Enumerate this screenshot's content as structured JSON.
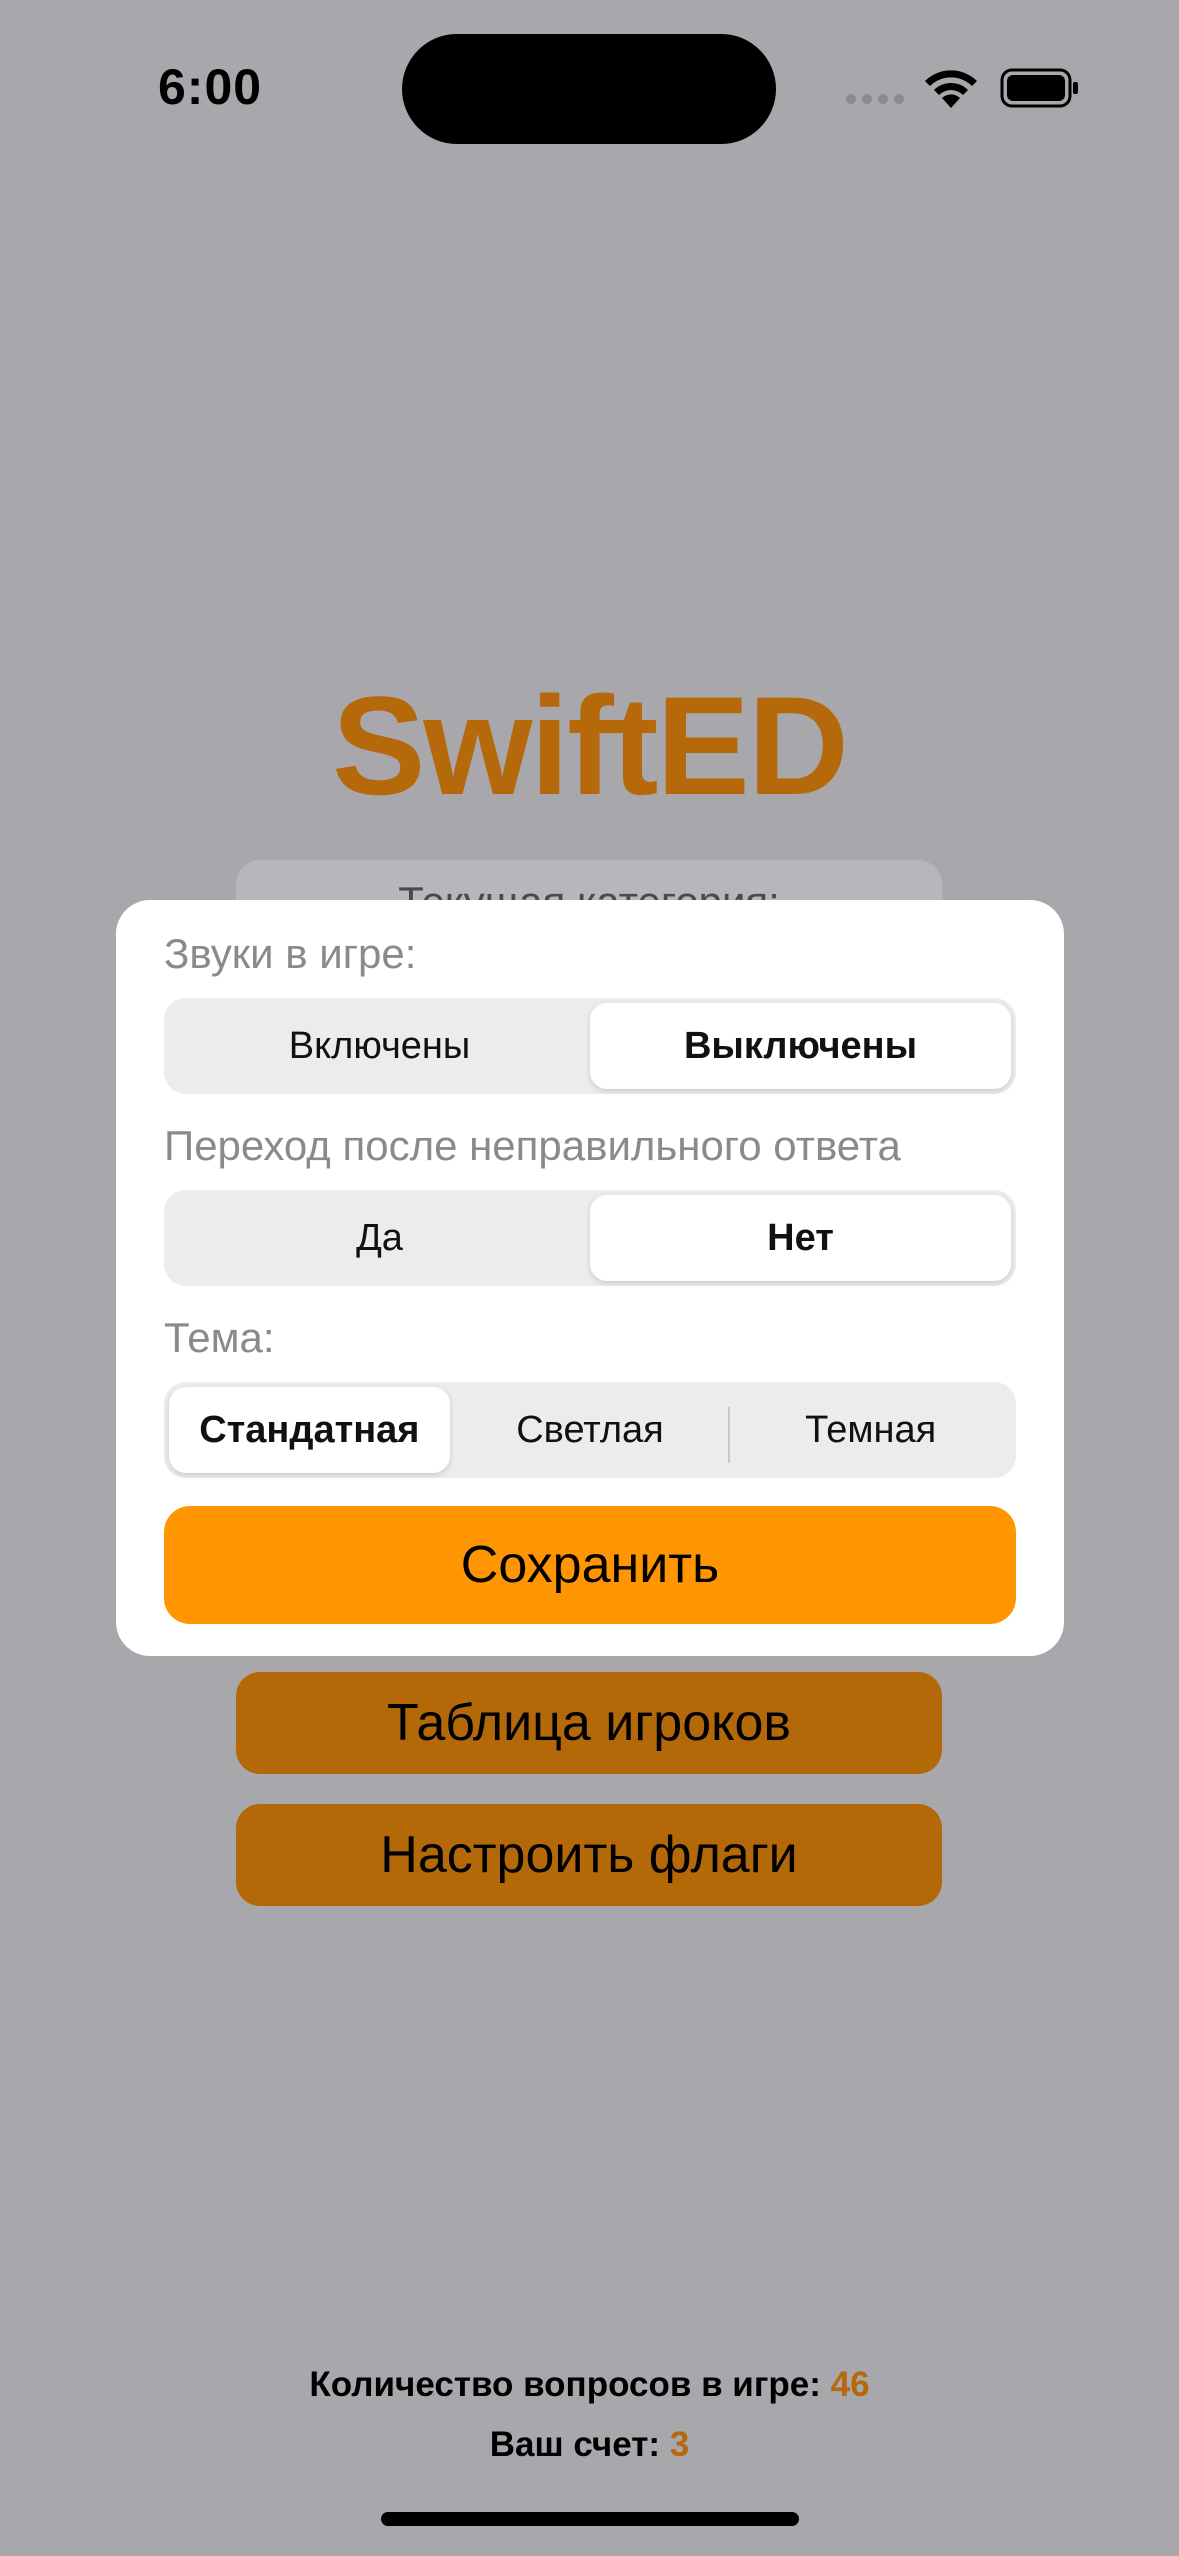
{
  "status_bar": {
    "time": "6:00",
    "icons": [
      "signal-dots-icon",
      "wifi-icon",
      "battery-icon"
    ]
  },
  "background": {
    "title": "SwiftED",
    "category_label": "Текущая категория:",
    "buttons": [
      {
        "label": "Таблица игроков"
      },
      {
        "label": "Настроить флаги"
      }
    ]
  },
  "footer": {
    "questions_label": "Количество вопросов в игре: ",
    "questions_value": "46",
    "score_label": "Ваш счет: ",
    "score_value": "3"
  },
  "settings_modal": {
    "sounds": {
      "label": "Звуки в игре:",
      "options": [
        "Включены",
        "Выключены"
      ],
      "selected": "Выключены"
    },
    "transition": {
      "label": "Переход после неправильного ответа",
      "options": [
        "Да",
        "Нет"
      ],
      "selected": "Нет"
    },
    "theme": {
      "label": "Тема:",
      "options": [
        "Стандатная",
        "Светлая",
        "Темная"
      ],
      "selected": "Стандатная"
    },
    "save_label": "Сохранить"
  },
  "colors": {
    "accent": "#b5690a",
    "button_orange": "#ff9500",
    "dimmed_button": "#b46908",
    "overlay_bg": "#a8a7ac"
  }
}
